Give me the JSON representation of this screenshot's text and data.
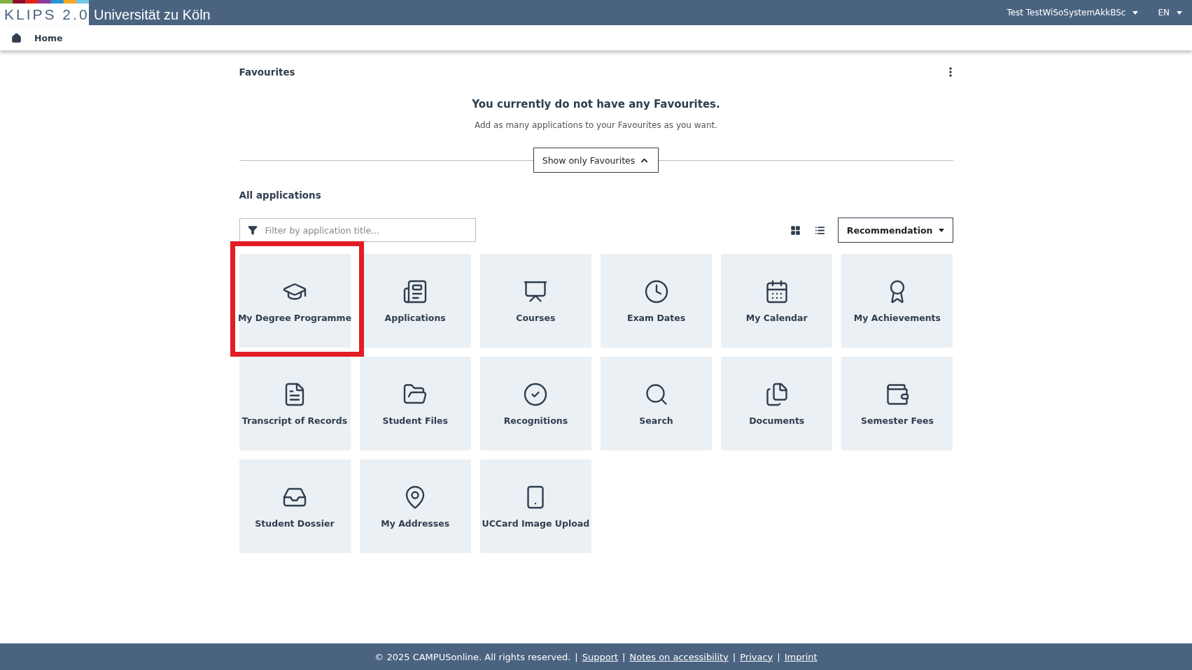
{
  "header": {
    "logo": "KLIPS 2.0",
    "university": "Universität zu Köln",
    "user": "Test TestWiSoSystemAkkBSc",
    "language": "EN"
  },
  "breadcrumb": {
    "label": "Home"
  },
  "favourites": {
    "title": "Favourites",
    "empty_title": "You currently do not have any Favourites.",
    "empty_text": "Add as many applications to your Favourites as you want.",
    "toggle": "Show only Favourites"
  },
  "all_applications": {
    "title": "All applications",
    "filter": {
      "placeholder": "Filter by application title..."
    },
    "sort": "Recommendation",
    "apps": [
      {
        "label": "My Degree Programme",
        "highlighted": true
      },
      {
        "label": "Applications",
        "highlighted": false
      },
      {
        "label": "Courses",
        "highlighted": false
      },
      {
        "label": "Exam Dates",
        "highlighted": false
      },
      {
        "label": "My Calendar",
        "highlighted": false
      },
      {
        "label": "My Achievements",
        "highlighted": false
      },
      {
        "label": "Transcript of Records",
        "highlighted": false
      },
      {
        "label": "Student Files",
        "highlighted": false
      },
      {
        "label": "Recognitions",
        "highlighted": false
      },
      {
        "label": "Search",
        "highlighted": false
      },
      {
        "label": "Documents",
        "highlighted": false
      },
      {
        "label": "Semester Fees",
        "highlighted": false
      },
      {
        "label": "Student Dossier",
        "highlighted": false
      },
      {
        "label": "My Addresses",
        "highlighted": false
      },
      {
        "label": "UCCard Image Upload",
        "highlighted": false
      }
    ]
  },
  "footer": {
    "copyright": "© 2025 CAMPUSonline. All rights reserved.",
    "separator": "|",
    "links": [
      "Support",
      "Notes on accessibility",
      "Privacy",
      "Imprint"
    ]
  }
}
